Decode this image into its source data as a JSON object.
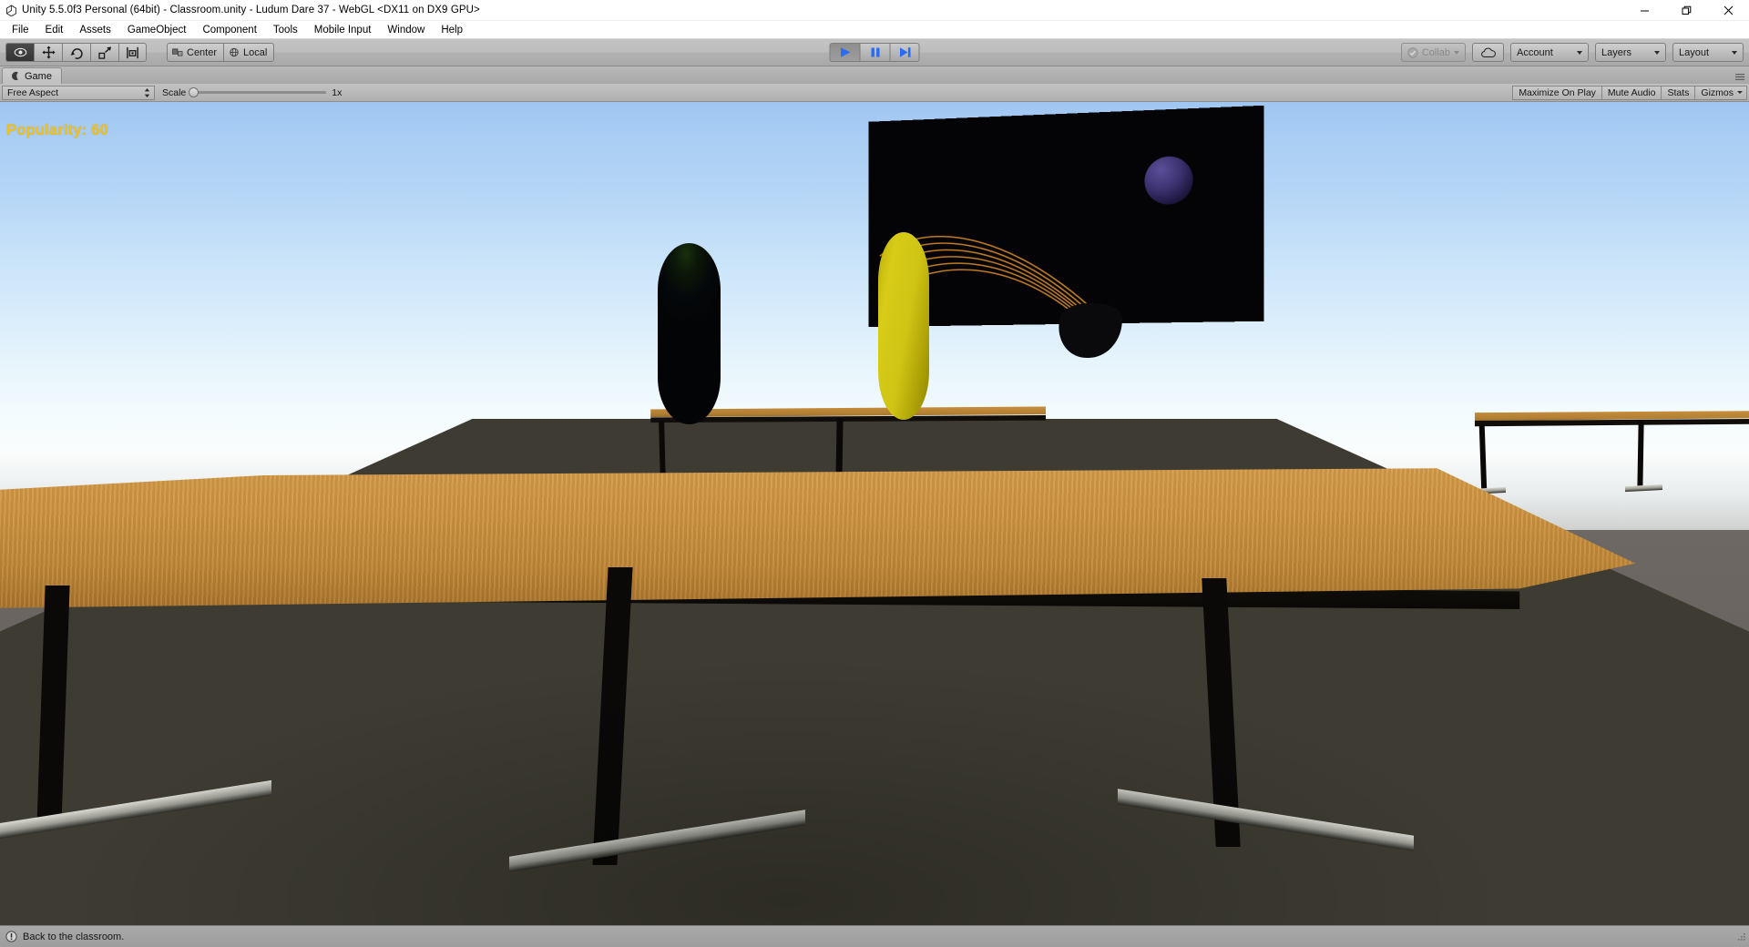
{
  "window": {
    "title": "Unity 5.5.0f3 Personal (64bit) - Classroom.unity - Ludum Dare 37 - WebGL <DX11 on DX9 GPU>",
    "logo_icon": "unity-logo-icon",
    "minimize_icon": "minimize-icon",
    "restore_icon": "restore-icon",
    "close_icon": "close-icon"
  },
  "menubar": {
    "items": [
      {
        "label": "File"
      },
      {
        "label": "Edit"
      },
      {
        "label": "Assets"
      },
      {
        "label": "GameObject"
      },
      {
        "label": "Component"
      },
      {
        "label": "Tools"
      },
      {
        "label": "Mobile Input"
      },
      {
        "label": "Window"
      },
      {
        "label": "Help"
      }
    ]
  },
  "toolbar": {
    "tools": [
      {
        "name": "hand-tool",
        "icon": "hand-icon",
        "active": true
      },
      {
        "name": "move-tool",
        "icon": "move-icon",
        "active": false
      },
      {
        "name": "rotate-tool",
        "icon": "rotate-icon",
        "active": false
      },
      {
        "name": "scale-tool",
        "icon": "scale-icon",
        "active": false
      },
      {
        "name": "rect-tool",
        "icon": "rect-transform-icon",
        "active": false
      }
    ],
    "pivot_mode": "Center",
    "pivot_rotation": "Local",
    "play_controls": [
      {
        "name": "play-button",
        "icon": "play-icon",
        "pressed": true
      },
      {
        "name": "pause-button",
        "icon": "pause-icon",
        "pressed": false
      },
      {
        "name": "step-button",
        "icon": "step-icon",
        "pressed": false
      }
    ],
    "collab_label": "Collab",
    "cloud_icon": "cloud-icon",
    "account_label": "Account",
    "layers_label": "Layers",
    "layout_label": "Layout"
  },
  "panel": {
    "tab_label": "Game",
    "tab_icon": "game-view-icon",
    "aspect": "Free Aspect",
    "scale_label": "Scale",
    "scale_value": "1x",
    "scale_percent": 0,
    "options": [
      {
        "label": "Maximize On Play"
      },
      {
        "label": "Mute Audio"
      },
      {
        "label": "Stats"
      },
      {
        "label": "Gizmos"
      }
    ]
  },
  "game": {
    "overlay_text": "Popularity: 60",
    "overlay_color": "#f4c117",
    "sky_top_color": "#9fc6f2",
    "horizon_color": "#fbfdfd",
    "ground_color": "#6d6763",
    "floor_color": "#3e3c32",
    "desk_wood_color": "#c98f3d",
    "desk_frame_color": "#0a0908",
    "blackboard_color": "#040406",
    "orb_color": "#3c3270",
    "trail_color": "#d4892a",
    "character_yellow": "#cfc314",
    "character_dark": "#0c1807"
  },
  "statusbar": {
    "icon": "info-icon",
    "message": "Back to the classroom.",
    "resize_grip_icon": "resize-grip-icon"
  }
}
